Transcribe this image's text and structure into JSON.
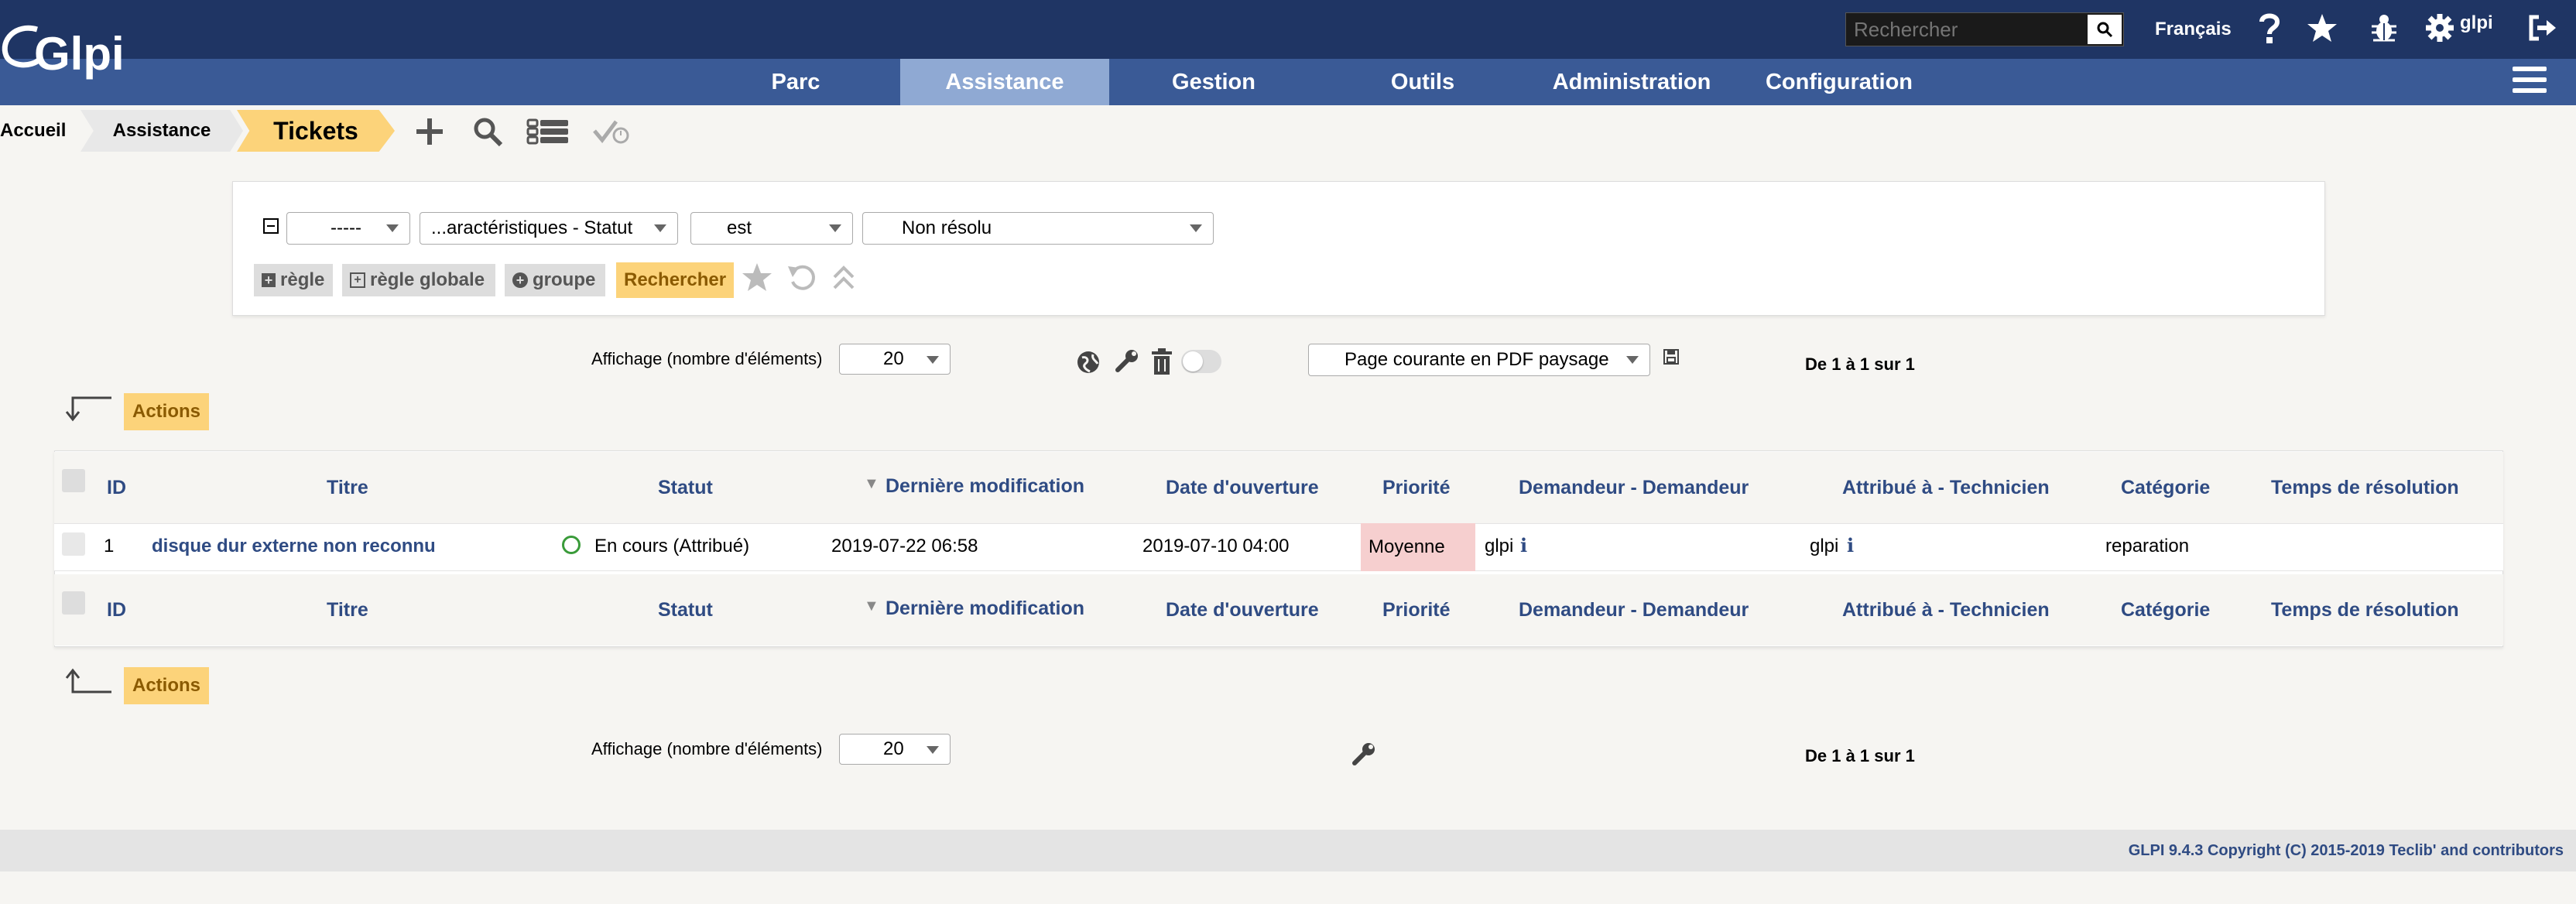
{
  "header": {
    "logo_text": "Glpi",
    "search_placeholder": "Rechercher",
    "language": "Français",
    "user": "glpi"
  },
  "nav": {
    "items": [
      {
        "label": "Parc",
        "active": false
      },
      {
        "label": "Assistance",
        "active": true
      },
      {
        "label": "Gestion",
        "active": false
      },
      {
        "label": "Outils",
        "active": false
      },
      {
        "label": "Administration",
        "active": false
      },
      {
        "label": "Configuration",
        "active": false
      }
    ]
  },
  "breadcrumb": {
    "home": "Accueil",
    "section": "Assistance",
    "current": "Tickets"
  },
  "search": {
    "link_select": "-----",
    "field_select": "...aractéristiques - Statut",
    "operator_select": "est",
    "value_select": "Non résolu",
    "btn_rule": "règle",
    "btn_global_rule": "règle globale",
    "btn_group": "groupe",
    "btn_search": "Rechercher"
  },
  "pager_top": {
    "display_label": "Affichage (nombre d'éléments)",
    "display_value": "20",
    "export_select": "Page courante en PDF paysage",
    "range": "De 1 à 1 sur 1"
  },
  "actions_label": "Actions",
  "table": {
    "headers": [
      "ID",
      "Titre",
      "Statut",
      "Dernière modification",
      "Date d'ouverture",
      "Priorité",
      "Demandeur - Demandeur",
      "Attribué à - Technicien",
      "Catégorie",
      "Temps de résolution"
    ],
    "sort_marker": "▼",
    "rows": [
      {
        "id": "1",
        "title": "disque dur externe non reconnu",
        "status": "En cours (Attribué)",
        "last_modified": "2019-07-22 06:58",
        "opened": "2019-07-10 04:00",
        "priority": "Moyenne",
        "requester": "glpi",
        "technician": "glpi",
        "category": "reparation",
        "resolution_time": ""
      }
    ]
  },
  "pager_bottom": {
    "display_label": "Affichage (nombre d'éléments)",
    "display_value": "20",
    "range": "De 1 à 1 sur 1"
  },
  "footer": {
    "copyright": "GLPI 9.4.3 Copyright (C) 2015-2019 Teclib' and contributors"
  },
  "colors": {
    "top_bar": "#1f3564",
    "nav_bar": "#3a5a96",
    "nav_active": "#8fa9d3",
    "accent_yellow": "#fcd37a",
    "header_text": "#2f4b83",
    "priority_medium": "#f6cfcf"
  },
  "icons": [
    "search-icon",
    "help-icon",
    "star-icon",
    "bug-icon",
    "gear-icon",
    "logout-icon",
    "menu-icon",
    "add-icon",
    "magnifier-icon",
    "list-icon",
    "check-clock-icon",
    "globe-icon",
    "wrench-icon",
    "trash-icon",
    "toggle-icon",
    "save-icon",
    "arrow-down-left-icon",
    "arrow-up-left-icon",
    "info-icon",
    "status-circle-icon"
  ]
}
